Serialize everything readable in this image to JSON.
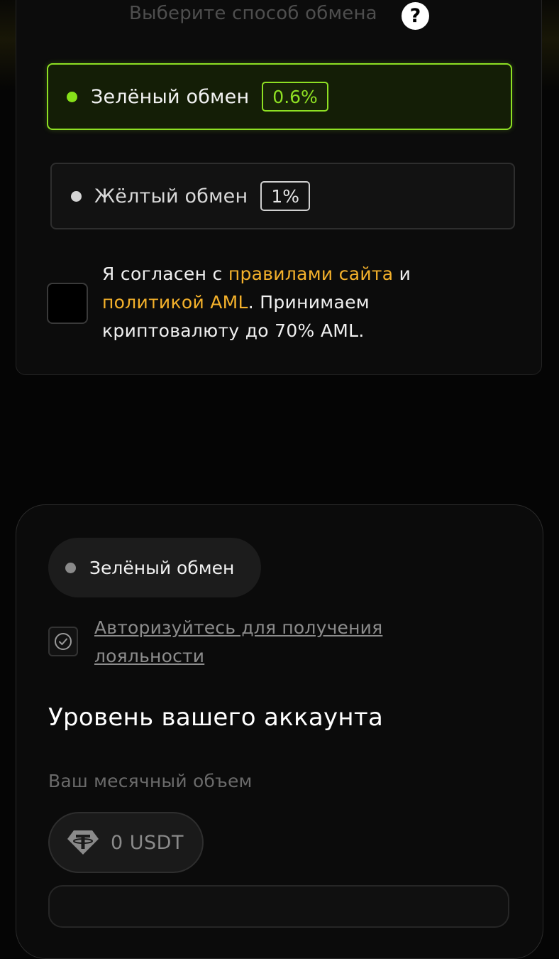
{
  "exchange": {
    "heading": "Выберите способ обмена",
    "help_icon": "question-circle-icon",
    "options": [
      {
        "label": "Зелёный обмен",
        "fee": "0.6%",
        "selected": true,
        "accent": "#8ee023"
      },
      {
        "label": "Жёлтый обмен",
        "fee": "1%",
        "selected": false
      }
    ],
    "agreement": {
      "checked": false,
      "prefix": "Я согласен с ",
      "rules_link": "правилами сайта",
      "and": " и ",
      "aml_link": "политикой AML",
      "suffix": ". Принимаем криптовалюту до 70% AML.",
      "link_color": "#f4b12b"
    }
  },
  "level": {
    "mode_label": "Зелёный обмен",
    "auth_link": "Авторизуйтесь для получения лояльности",
    "title": "Уровень вашего аккаунта",
    "volume_label": "Ваш месячный объем",
    "volume_value": "0 USDT",
    "volume_icon": "tether-icon"
  }
}
